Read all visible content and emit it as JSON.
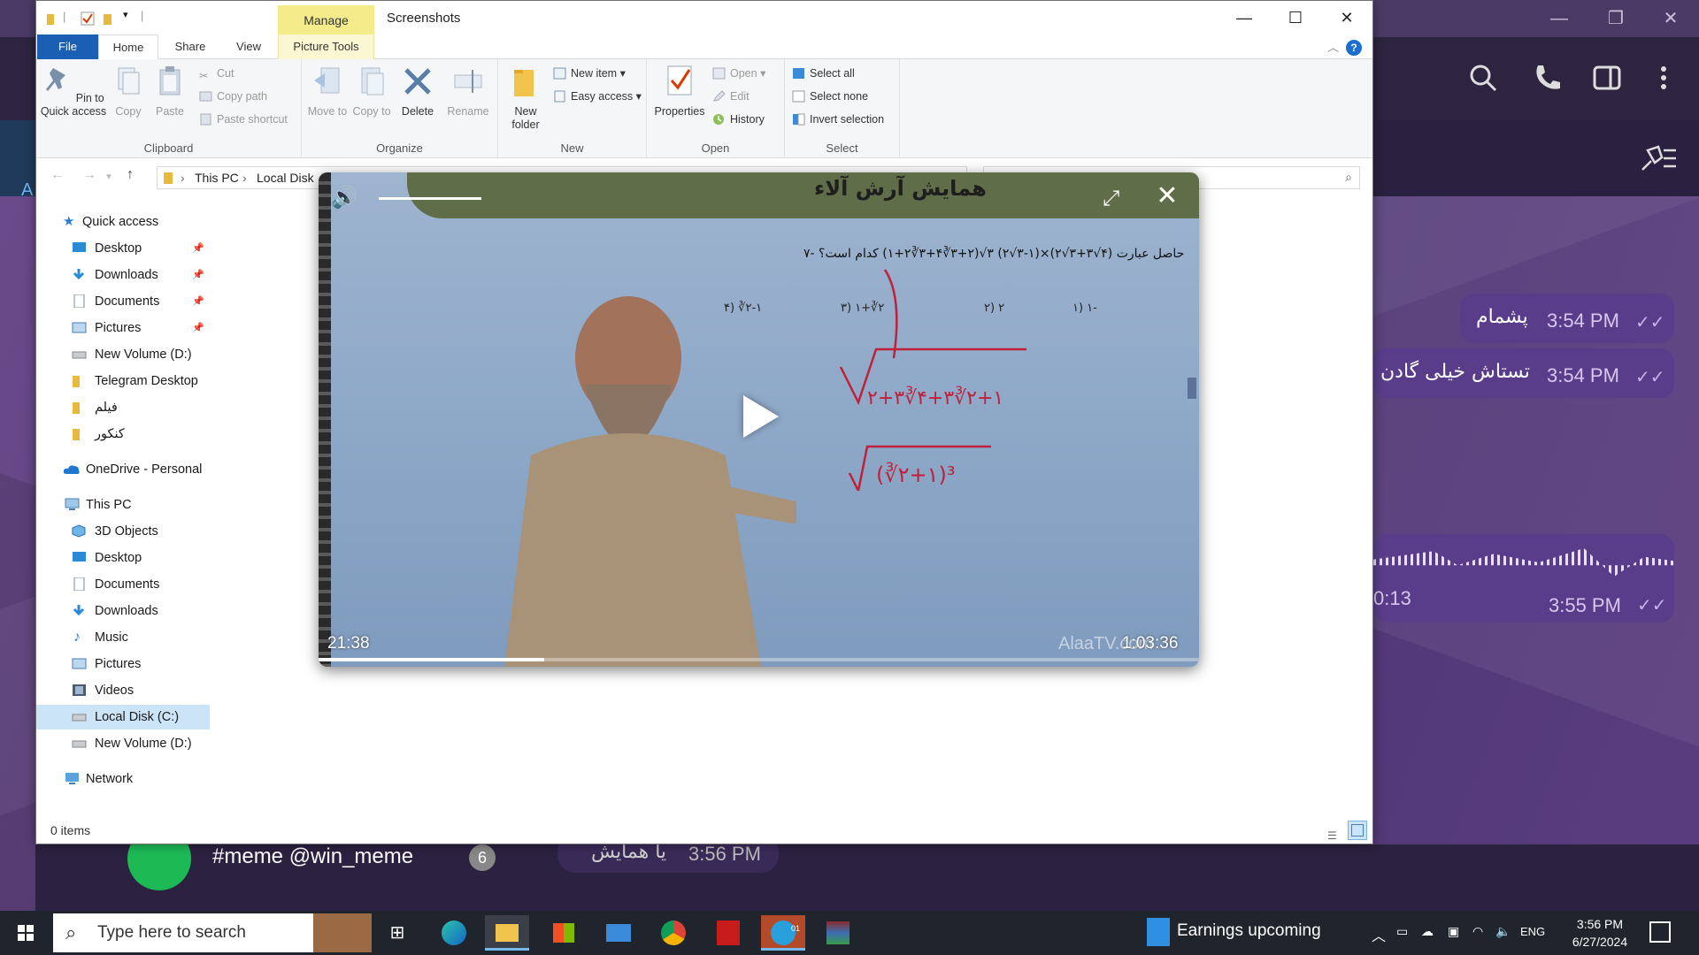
{
  "telegram": {
    "messages": [
      {
        "text": "پشمام",
        "time": "3:54 PM"
      },
      {
        "text": "تستاش خیلی گادن",
        "time": "3:54 PM"
      },
      {
        "voice_duration": "0:13",
        "time": "3:55 PM"
      }
    ],
    "chat_preview": {
      "title": "#meme @win_meme",
      "badge": "6",
      "snippet": "یا همایش",
      "time": "3:56 PM"
    },
    "left_label": "A"
  },
  "explorer": {
    "title": "Screenshots",
    "manage_tab": "Manage",
    "tabs": [
      "File",
      "Home",
      "Share",
      "View",
      "Picture Tools"
    ],
    "ribbon": {
      "clipboard": {
        "label": "Clipboard",
        "pin_to_quick_access": "Pin to Quick access",
        "copy": "Copy",
        "paste": "Paste",
        "cut": "Cut",
        "copy_path": "Copy path",
        "paste_shortcut": "Paste shortcut"
      },
      "organize": {
        "label": "Organize",
        "move_to": "Move to",
        "copy_to": "Copy to",
        "delete": "Delete",
        "rename": "Rename"
      },
      "new": {
        "label": "New",
        "new_folder": "New folder",
        "new_item": "New item",
        "easy_access": "Easy access"
      },
      "open": {
        "label": "Open",
        "properties": "Properties",
        "open": "Open",
        "edit": "Edit",
        "history": "History"
      },
      "select": {
        "label": "Select",
        "select_all": "Select all",
        "select_none": "Select none",
        "invert_selection": "Invert selection"
      }
    },
    "address": {
      "part1": "This PC",
      "part2": "Local Disk"
    },
    "nav": {
      "quick_access": "Quick access",
      "quick_items": [
        "Desktop",
        "Downloads",
        "Documents",
        "Pictures",
        "New Volume (D:)",
        "Telegram Desktop",
        "فیلم",
        "کنکور"
      ],
      "onedrive": "OneDrive - Personal",
      "this_pc": "This PC",
      "pc_items": [
        "3D Objects",
        "Desktop",
        "Documents",
        "Downloads",
        "Music",
        "Pictures",
        "Videos",
        "Local Disk (C:)",
        "New Volume (D:)"
      ],
      "network": "Network"
    },
    "status": "0 items"
  },
  "player": {
    "board_title": "همایش آرش آلاء",
    "question": "۷- حاصل عبارت (۴√۳+۳√۲)×(۱-۳√۲) ۳√(۲+۳∛۴+۳∛۲+۱) کدام است؟",
    "options": [
      "۱) ۱-",
      "۲) ۲",
      "۳) ۱+∛۲",
      "۴) ∛۲-۱"
    ],
    "current_time": "21:38",
    "duration": "1:03:36",
    "watermark": "AlaaTV.com",
    "progress": 0.256,
    "volume": 0.75
  },
  "taskbar": {
    "search_placeholder": "Type here to search",
    "news": "Earnings upcoming",
    "lang": "ENG",
    "time": "3:56 PM",
    "date": "6/27/2024",
    "telegram_badge": "01"
  }
}
